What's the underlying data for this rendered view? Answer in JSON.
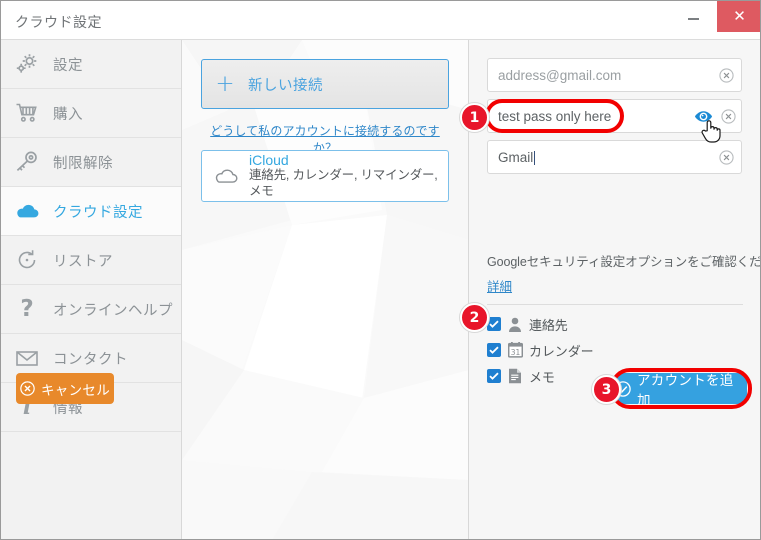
{
  "window": {
    "title": "クラウド設定",
    "minimize_label": "−",
    "close_label": "✕",
    "close_color": "#de5a61"
  },
  "sidebar": {
    "items": [
      {
        "label": "設定",
        "icon": "gear-icon",
        "active": false
      },
      {
        "label": "購入",
        "icon": "cart-icon",
        "active": false
      },
      {
        "label": "制限解除",
        "icon": "key-icon",
        "active": false
      },
      {
        "label": "クラウド設定",
        "icon": "cloud-icon",
        "active": true
      },
      {
        "label": "リストア",
        "icon": "restore-icon",
        "active": false
      },
      {
        "label": "オンラインヘルプ",
        "icon": "question-icon",
        "active": false
      },
      {
        "label": "コンタクト",
        "icon": "envelope-icon",
        "active": false
      },
      {
        "label": "情報",
        "icon": "info-icon",
        "active": false
      }
    ],
    "active_color": "#35a8e0"
  },
  "middle": {
    "new_connection_label": "新しい接続",
    "new_connection_plus": "+",
    "why_link": "どうして私のアカウントに接続するのですか？",
    "provider": {
      "name": "iCloud",
      "services": "連絡先, カレンダー, リマインダー, メモ",
      "icon": "cloud-outline-icon"
    }
  },
  "form": {
    "fields": [
      {
        "name": "email",
        "value": "address@gmail.com",
        "is_placeholder": true,
        "has_eye": false,
        "clear_icon": "clear-circle-icon"
      },
      {
        "name": "password",
        "value": "test pass only here",
        "is_placeholder": false,
        "has_eye": true,
        "eye_icon": "eye-icon",
        "clear_icon": "clear-circle-icon"
      },
      {
        "name": "account-name",
        "value": "Gmail",
        "is_placeholder": false,
        "has_eye": false,
        "clear_icon": "clear-circle-icon"
      }
    ],
    "google_note": "Googleセキュリティ設定オプションをご確認ください。",
    "detail_link": "詳細",
    "checkboxes": [
      {
        "label": "連絡先",
        "checked": true,
        "icon": "person-icon"
      },
      {
        "label": "カレンダー",
        "checked": true,
        "icon": "calendar-icon"
      },
      {
        "label": "メモ",
        "checked": true,
        "icon": "note-icon"
      }
    ],
    "cancel_button": {
      "label": "キャンセル",
      "icon": "cancel-circle-icon",
      "color": "#e8892b"
    },
    "add_button": {
      "label": "アカウントを追加",
      "icon": "check-circle-icon",
      "color": "#35a1e0"
    }
  },
  "annotations": {
    "badges": [
      {
        "number": "1",
        "target": "password-field"
      },
      {
        "number": "2",
        "target": "checkbox-list"
      },
      {
        "number": "3",
        "target": "add-account-button"
      }
    ],
    "highlight_color": "#f20000",
    "badge_color": "#e8152a"
  }
}
